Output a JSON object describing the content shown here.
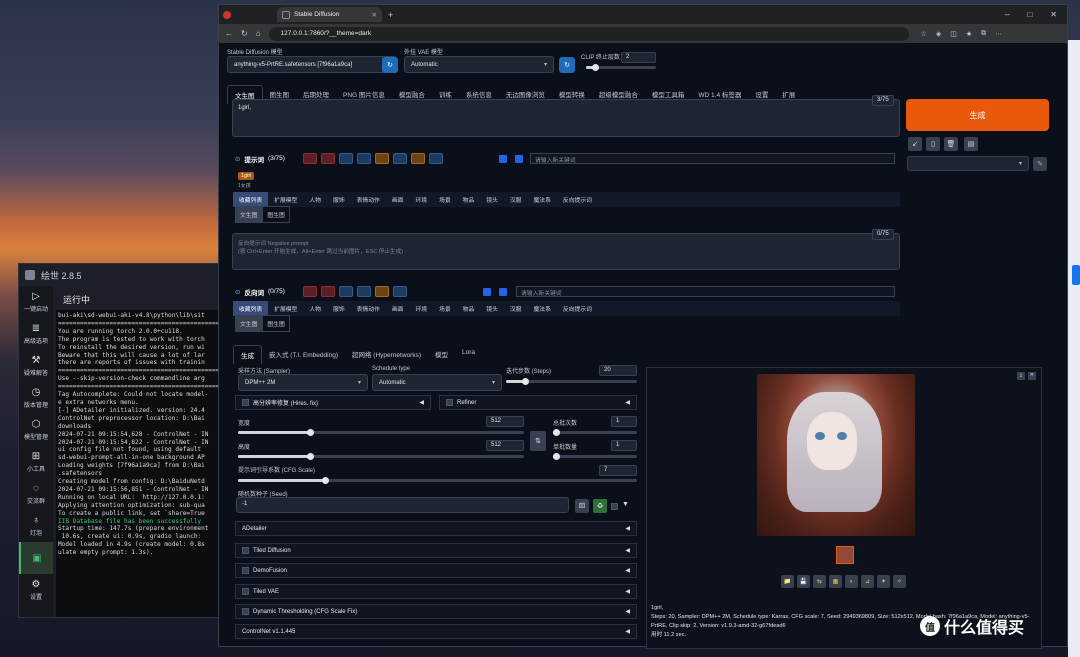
{
  "browser": {
    "tab_title": "Stable Diffusion",
    "url": "127.0.0.1:7860/?__theme=dark"
  },
  "launcher": {
    "title": "绘世 2.8.5",
    "status": "运行中",
    "sidebar": [
      "一键启动",
      "高级选项",
      "疑难解答",
      "版本管理",
      "模型管理",
      "小工具",
      "交流群",
      "灯泡",
      "",
      "设置"
    ],
    "terminal": [
      "bui-aki\\sd-webui-aki-v4.8\\python\\lib\\sit",
      "================================================",
      "You are running torch 2.0.0+cu118.",
      "The program is tested to work with torch",
      "To reinstall the desired version, run wi",
      "Beware that this will cause a lot of lar",
      "there are reports of issues with trainin",
      "================================================",
      "",
      "Use --skip-version-check commandline arg",
      "================================================",
      "Tag Autocomplete: Could not locate model-",
      "e extra networks menu.",
      "[-] ADetailer initialized. version: 24.4",
      "ControlNet preprocessor location: D:\\Bai",
      "downloads",
      "2024-07-21 09:15:54,628 - ControlNet - IN",
      "2024-07-21 09:15:54,822 - ControlNet - IN",
      "ui config file not found, using default",
      "sd-webui-prompt-all-in-one background AP",
      "Loading weights [7f96a1a9ca] from D:\\Bai",
      ".safetensors",
      "Creating model from config: D:\\BaiduNetd",
      "2024-07-21 09:15:56,851 - ControlNet - IN",
      "Running on local URL:  http://127.0.0.1:",
      "Applying attention optimization: sub-qua",
      "",
      "To create a public link, set `share=True",
      "IIB Database file has been successfully",
      "Startup time: 147.7s (prepare environment",
      " 10.6s, create ui: 0.9s, gradio launch: ",
      "Model loaded in 4.9s (create model: 0.8s",
      "ulate empty prompt: 1.3s)."
    ]
  },
  "sd": {
    "model_label": "Stable Diffusion 模型",
    "model_value": "anything-v5-PrtRE.safetensors [7f96a1a9ca]",
    "vae_label": "外挂 VAE 模型",
    "vae_value": "Automatic",
    "clip_label": "CLIP 终止层数",
    "clip_value": "2",
    "tabs": [
      "文生图",
      "图生图",
      "后期处理",
      "PNG 图片信息",
      "模型融合",
      "训练",
      "系统信息",
      "无边图像浏览",
      "模型转换",
      "超级模型融合",
      "模型工具箱",
      "WD 1.4 标签器",
      "设置",
      "扩展"
    ],
    "prompt": "1girl,",
    "prompt_count": "3/75",
    "neg_placeholder": "反向提示词 Negative prompt\n(按 Ctrl+Enter 开始生成，Alt+Enter 跳过当前图片，ESC 停止生成)",
    "neg_count": "0/75",
    "generate": "生成",
    "pos_header": "提示词",
    "pos_header_count": "(3/75)",
    "neg_header": "反向词",
    "neg_header_count": "(0/75)",
    "keyword_placeholder": "请输入新关键词",
    "tag_chip": "1girl",
    "tag_chip_sub": "1女孩",
    "cat_tabs": [
      "收藏列表",
      "扩展模型",
      "人物",
      "服饰",
      "表情动作",
      "画面",
      "环境",
      "场景",
      "物品",
      "镜头",
      "汉服",
      "魔法系",
      "反向提示词"
    ],
    "sub_tabs": [
      "文生图",
      "图生图"
    ],
    "gen_tabs": [
      "生成",
      "嵌入式 (T.I. Embedding)",
      "超网络 (Hypernetworks)",
      "模型",
      "Lora"
    ],
    "sampler_label": "采样方法 (Sampler)",
    "sampler_value": "DPM++ 2M",
    "schedule_label": "Schedule type",
    "schedule_value": "Automatic",
    "steps_label": "迭代步数 (Steps)",
    "steps_value": "20",
    "hires_label": "高分辨率修复 (Hires. fix)",
    "refiner_label": "Refiner",
    "width_label": "宽度",
    "width_value": "512",
    "height_label": "高度",
    "height_value": "512",
    "batch_count_label": "总批次数",
    "batch_count_value": "1",
    "batch_size_label": "单批数量",
    "batch_size_value": "1",
    "cfg_label": "提示词引导系数 (CFG Scale)",
    "cfg_value": "7",
    "seed_label": "随机数种子 (Seed)",
    "seed_value": "-1",
    "accordions": [
      "ADetailer",
      "Tiled Diffusion",
      "DemoFusion",
      "Tiled VAE",
      "Dynamic Thresholding (CFG Scale Fix)",
      "ControlNet v1.1.445"
    ],
    "out_prompt": "1girl,",
    "out_params": "Steps: 20, Sampler: DPM++ 2M, Schedule type: Karras, CFG scale: 7, Seed: 2949369809, Size: 512x512, Model hash: 7f96a1a9ca, Model: anything-v5-PrtRE, Clip skip: 2, Version: v1.9.3-amd-32-g67fdead6",
    "out_time": "用时 11.2 sec."
  },
  "watermark": "什么值得买",
  "watermark_icon": "值"
}
